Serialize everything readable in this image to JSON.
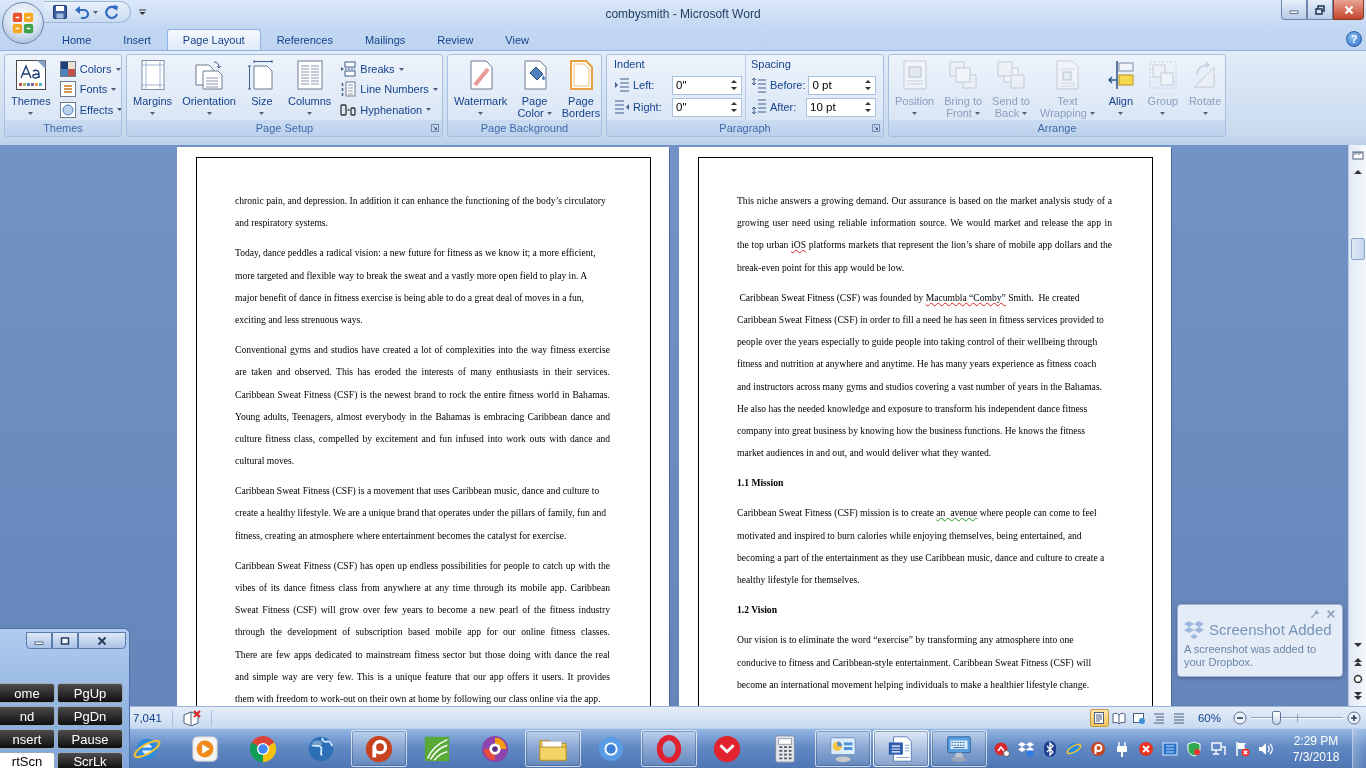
{
  "window": {
    "title": "combysmith - Microsoft Word"
  },
  "tabs": [
    {
      "label": "Home",
      "selected": false
    },
    {
      "label": "Insert",
      "selected": false
    },
    {
      "label": "Page Layout",
      "selected": true
    },
    {
      "label": "References",
      "selected": false
    },
    {
      "label": "Mailings",
      "selected": false
    },
    {
      "label": "Review",
      "selected": false
    },
    {
      "label": "View",
      "selected": false
    }
  ],
  "help": {
    "label": "?"
  },
  "ribbon": {
    "groups": [
      {
        "kind": "buttons",
        "label": "Themes",
        "launcher": false,
        "buttons": [
          {
            "kind": "large",
            "lines": [
              "Themes"
            ],
            "menu": true,
            "disabled": false
          },
          {
            "kind": "small",
            "lines": [
              "Colors"
            ],
            "menu": true,
            "disabled": false
          },
          {
            "kind": "small",
            "lines": [
              "Fonts"
            ],
            "menu": true,
            "disabled": false
          },
          {
            "kind": "small",
            "lines": [
              "Effects"
            ],
            "menu": true,
            "disabled": false
          }
        ]
      },
      {
        "kind": "buttons",
        "label": "Page Setup",
        "launcher": true,
        "buttons": [
          {
            "kind": "large",
            "lines": [
              "Margins"
            ],
            "menu": true,
            "disabled": false
          },
          {
            "kind": "large",
            "lines": [
              "Orientation"
            ],
            "menu": true,
            "disabled": false
          },
          {
            "kind": "large",
            "lines": [
              "Size"
            ],
            "menu": true,
            "disabled": false
          },
          {
            "kind": "large",
            "lines": [
              "Columns"
            ],
            "menu": true,
            "disabled": false
          },
          {
            "kind": "small",
            "lines": [
              "Breaks"
            ],
            "menu": true,
            "disabled": false
          },
          {
            "kind": "small",
            "lines": [
              "Line Numbers"
            ],
            "menu": true,
            "disabled": false
          },
          {
            "kind": "small",
            "lines": [
              "Hyphenation"
            ],
            "menu": true,
            "disabled": false
          }
        ]
      },
      {
        "kind": "buttons",
        "label": "Page Background",
        "launcher": false,
        "buttons": [
          {
            "kind": "large",
            "lines": [
              "Watermark"
            ],
            "menu": true,
            "disabled": false
          },
          {
            "kind": "large",
            "lines": [
              "Page",
              "Color"
            ],
            "menu": true,
            "disabled": false
          },
          {
            "kind": "large",
            "lines": [
              "Page",
              "Borders"
            ],
            "menu": false,
            "disabled": false
          }
        ]
      },
      {
        "kind": "fields",
        "label": "Paragraph",
        "launcher": true,
        "sections": [
          {
            "title": "Indent",
            "fields": [
              {
                "label": "Left:",
                "value": "0\""
              },
              {
                "label": "Right:",
                "value": "0\""
              }
            ]
          },
          {
            "title": "Spacing",
            "fields": [
              {
                "label": "Before:",
                "value": "0 pt"
              },
              {
                "label": "After:",
                "value": "10 pt"
              }
            ]
          }
        ]
      },
      {
        "kind": "buttons",
        "label": "Arrange",
        "launcher": false,
        "buttons": [
          {
            "kind": "large",
            "lines": [
              "Position"
            ],
            "menu": true,
            "disabled": true
          },
          {
            "kind": "large",
            "lines": [
              "Bring to",
              "Front"
            ],
            "menu": true,
            "disabled": true
          },
          {
            "kind": "large",
            "lines": [
              "Send to",
              "Back"
            ],
            "menu": true,
            "disabled": true
          },
          {
            "kind": "large",
            "lines": [
              "Text",
              "Wrapping"
            ],
            "menu": true,
            "disabled": true
          },
          {
            "kind": "large",
            "lines": [
              "Align"
            ],
            "menu": true,
            "disabled": false
          },
          {
            "kind": "large",
            "lines": [
              "Group"
            ],
            "menu": true,
            "disabled": true
          },
          {
            "kind": "large",
            "lines": [
              "Rotate"
            ],
            "menu": true,
            "disabled": true
          }
        ]
      }
    ]
  },
  "document": {
    "pages": [
      {
        "paragraphs": [
          {
            "kind": "body",
            "justified": false,
            "lines": [
              [
                {
                  "kind": "plain",
                  "text": "chronic pain, and depression. In addition it can enhance the functioning of the body’s circulatory"
                }
              ],
              [
                {
                  "kind": "plain",
                  "text": "and respiratory systems."
                }
              ]
            ]
          },
          {
            "kind": "body",
            "justified": false,
            "lines": [
              [
                {
                  "kind": "plain",
                  "text": "Today, dance peddles a radical vision: a new future for fitness as we know it; a more efficient,"
                }
              ],
              [
                {
                  "kind": "plain",
                  "text": "more targeted and flexible way to break the sweat and a vastly more open field to play in. A"
                }
              ],
              [
                {
                  "kind": "plain",
                  "text": "major benefit of dance in fitness exercise is being able to do a great deal of moves in a fun,"
                }
              ],
              [
                {
                  "kind": "plain",
                  "text": "exciting and less strenuous ways."
                }
              ]
            ]
          },
          {
            "kind": "body",
            "justified": true,
            "lines": [
              [
                {
                  "kind": "plain",
                  "text": "Conventional gyms and studios have created a lot of complexities into the way fitness exercise"
                }
              ],
              [
                {
                  "kind": "plain",
                  "text": "are taken and observed. This has eroded the interests of many enthusiasts in their services."
                }
              ],
              [
                {
                  "kind": "plain",
                  "text": "Caribbean Sweat Fitness (CSF) is the newest brand to rock the entire fitness world in Bahamas."
                }
              ],
              [
                {
                  "kind": "plain",
                  "text": "Young adults, Teenagers, almost everybody in the Bahamas is embracing Caribbean dance and"
                }
              ],
              [
                {
                  "kind": "plain",
                  "text": "culture fitness class, compelled by excitement and fun infused into work outs with dance and"
                }
              ],
              [
                {
                  "kind": "plain",
                  "text": "cultural moves."
                }
              ]
            ]
          },
          {
            "kind": "body",
            "justified": false,
            "lines": [
              [
                {
                  "kind": "plain",
                  "text": "Caribbean Sweat Fitness (CSF) is a movement that uses Caribbean music, dance and culture to"
                }
              ],
              [
                {
                  "kind": "plain",
                  "text": "create a healthy lifestyle. We are a unique brand that operates under the pillars of family, fun and"
                }
              ],
              [
                {
                  "kind": "plain",
                  "text": "fitness, creating an atmosphere where entertainment becomes the catalyst for exercise."
                }
              ]
            ]
          },
          {
            "kind": "body",
            "justified": true,
            "lines": [
              [
                {
                  "kind": "plain",
                  "text": "Caribbean Sweat Fitness (CSF) has open up endless possibilities for people to catch up with the"
                }
              ],
              [
                {
                  "kind": "plain",
                  "text": "vibes of its dance fitness class from anywhere at any time through its mobile app. Caribbean"
                }
              ],
              [
                {
                  "kind": "plain",
                  "text": "Sweat Fitness (CSF) will grow over few years to become a new pearl of the fitness industry"
                }
              ],
              [
                {
                  "kind": "plain",
                  "text": "through the development of subscription based mobile app for our online fitness classes."
                }
              ],
              [
                {
                  "kind": "plain",
                  "text": "There are few apps dedicated to mainstream fitness sector but those doing with dance the real"
                }
              ],
              [
                {
                  "kind": "plain",
                  "text": "and simple way are very few. This is a unique feature that our app offers it users. It provides"
                }
              ],
              [
                {
                  "kind": "plain",
                  "text": "them with freedom to work-out on their own at home by following our class online via the app."
                }
              ]
            ]
          }
        ]
      },
      {
        "paragraphs": [
          {
            "kind": "body",
            "justified": true,
            "lines": [
              [
                {
                  "kind": "plain",
                  "text": "This niche answers a growing demand. Our assurance is based on the market analysis study of a"
                }
              ],
              [
                {
                  "kind": "plain",
                  "text": "growing user need using reliable information source. We would market and release the app in"
                }
              ],
              [
                {
                  "kind": "plain",
                  "text": "the top urban "
                },
                {
                  "kind": "spelling",
                  "text": "iOS"
                },
                {
                  "kind": "plain",
                  "text": " platforms markets that represent the lion’s share of mobile app dollars and the"
                }
              ],
              [
                {
                  "kind": "plain",
                  "text": "break-even point for this app would be low."
                }
              ]
            ]
          },
          {
            "kind": "body",
            "justified": false,
            "lines": [
              [
                {
                  "kind": "plain",
                  "text": " Caribbean Sweat Fitness (CSF) was founded by "
                },
                {
                  "kind": "spelling",
                  "text": "Macumbla “Comby”"
                },
                {
                  "kind": "plain",
                  "text": " Smith.  He created"
                }
              ],
              [
                {
                  "kind": "plain",
                  "text": "Caribbean Sweat Fitness (CSF) in order to fill a need he has seen in fitness services provided to"
                }
              ],
              [
                {
                  "kind": "plain",
                  "text": "people over the years especially to guide people into taking control of their wellbeing through"
                }
              ],
              [
                {
                  "kind": "plain",
                  "text": "fitness and nutrition at anywhere and anytime. He has many years experience as fitness coach"
                }
              ],
              [
                {
                  "kind": "plain",
                  "text": "and instructors across many gyms and studios covering a vast number of years in the Bahamas."
                }
              ],
              [
                {
                  "kind": "plain",
                  "text": "He also has the needed knowledge and exposure to transform his independent dance fitness"
                }
              ],
              [
                {
                  "kind": "plain",
                  "text": "company into great business by knowing how the business functions. He knows the fitness"
                }
              ],
              [
                {
                  "kind": "plain",
                  "text": "market audiences in and out, and would deliver what they wanted."
                }
              ]
            ]
          },
          {
            "kind": "heading",
            "lines": [
              [
                {
                  "kind": "plain",
                  "text": "1.1 Mission"
                }
              ]
            ]
          },
          {
            "kind": "body",
            "justified": false,
            "lines": [
              [
                {
                  "kind": "plain",
                  "text": "Caribbean Sweat Fitness (CSF) mission is to create "
                },
                {
                  "kind": "grammar",
                  "text": "an  avenue"
                },
                {
                  "kind": "plain",
                  "text": " where people can come to feel"
                }
              ],
              [
                {
                  "kind": "plain",
                  "text": "motivated and inspired to burn calories while enjoying themselves, being entertained, and"
                }
              ],
              [
                {
                  "kind": "plain",
                  "text": "becoming a part of the entertainment as they use Caribbean music, dance and culture to create a"
                }
              ],
              [
                {
                  "kind": "plain",
                  "text": "healthy lifestyle for themselves."
                }
              ]
            ]
          },
          {
            "kind": "heading",
            "lines": [
              [
                {
                  "kind": "plain",
                  "text": "1.2 Vision"
                }
              ]
            ]
          },
          {
            "kind": "body",
            "justified": false,
            "lines": [
              [
                {
                  "kind": "plain",
                  "text": "Our vision is to eliminate the word “exercise” by transforming any atmosphere into one"
                }
              ],
              [
                {
                  "kind": "plain",
                  "text": "conducive to fitness and Caribbean-style entertainment. Caribbean Sweat Fitness (CSF) will"
                }
              ],
              [
                {
                  "kind": "plain",
                  "text": "become an international movement helping individuals to make a healthier lifestyle change."
                }
              ]
            ]
          }
        ]
      }
    ]
  },
  "status_bar": {
    "word_count": "7,041",
    "views": [
      {
        "selected": true
      },
      {
        "selected": false
      },
      {
        "selected": false
      },
      {
        "selected": false
      },
      {
        "selected": false
      }
    ],
    "zoom": {
      "label": "60%",
      "level": 0.28
    }
  },
  "notification": {
    "title": "Screenshot Added",
    "message": "A screenshot was added to your Dropbox."
  },
  "keyboard": {
    "keys": [
      {
        "label": "ome",
        "pressed": false
      },
      {
        "label": "PgUp",
        "pressed": false
      },
      {
        "label": "nd",
        "pressed": false
      },
      {
        "label": "PgDn",
        "pressed": false
      },
      {
        "label": "nsert",
        "pressed": false
      },
      {
        "label": "Pause",
        "pressed": false
      },
      {
        "label": "rtScn",
        "pressed": true
      },
      {
        "label": "ScrLk",
        "pressed": false
      }
    ]
  },
  "taskbar": {
    "apps": [
      {
        "running": false,
        "active": false
      },
      {
        "running": false,
        "active": false
      },
      {
        "running": false,
        "active": false
      },
      {
        "running": false,
        "active": false
      },
      {
        "running": true,
        "active": false
      },
      {
        "running": false,
        "active": false
      },
      {
        "running": false,
        "active": false
      },
      {
        "running": true,
        "active": false
      },
      {
        "running": false,
        "active": false
      },
      {
        "running": true,
        "active": false
      },
      {
        "running": false,
        "active": false
      },
      {
        "running": false,
        "active": false
      },
      {
        "running": true,
        "active": false
      },
      {
        "running": true,
        "active": true
      },
      {
        "running": true,
        "active": false
      }
    ],
    "clock": {
      "time": "2:29 PM",
      "date": "7/3/2018"
    }
  }
}
